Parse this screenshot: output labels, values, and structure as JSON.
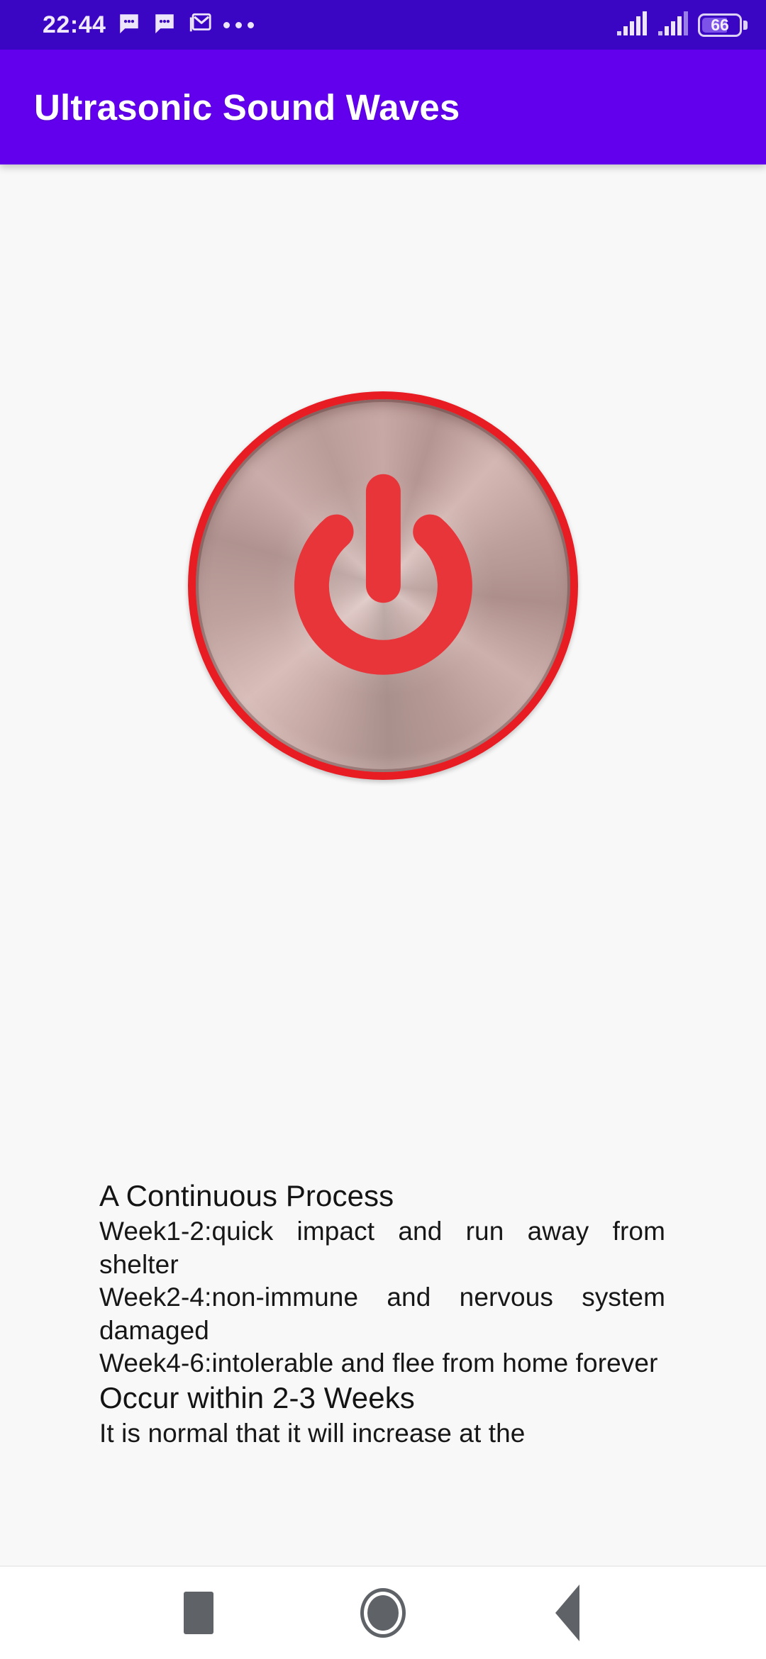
{
  "status_bar": {
    "time": "22:44",
    "icons": [
      "message-icon",
      "message-icon",
      "gmail-icon",
      "more-notifications-icon"
    ],
    "signal_icons": [
      "signal-bars-icon",
      "signal-bars-icon"
    ],
    "battery_level": "66",
    "battery_percent": 66,
    "background_color": "#3A05C3"
  },
  "app_bar": {
    "title": "Ultrasonic Sound Waves",
    "background_color": "#6200EE",
    "text_color": "#FFFFFF"
  },
  "main": {
    "power_button": {
      "icon": "power-icon",
      "ring_color": "#E81C23",
      "glyph_color": "#E8353A",
      "face_color": "#C2A29E",
      "state": "off"
    },
    "info": [
      {
        "type": "heading",
        "text": "A Continuous Process"
      },
      {
        "type": "paragraph",
        "text": "Week1-2:quick impact and run away from shelter"
      },
      {
        "type": "paragraph",
        "text": "Week2-4:non-immune and nervous system damaged"
      },
      {
        "type": "paragraph",
        "text": "Week4-6:intolerable and flee from home forever"
      },
      {
        "type": "heading",
        "text": "Occur within 2-3 Weeks"
      },
      {
        "type": "paragraph",
        "text": "It is normal that it will increase at the"
      }
    ],
    "background_color": "#F8F8F8"
  },
  "nav_bar": {
    "buttons": [
      {
        "name": "recents",
        "icon": "square-icon"
      },
      {
        "name": "home",
        "icon": "circle-icon"
      },
      {
        "name": "back",
        "icon": "triangle-left-icon"
      }
    ],
    "background_color": "#FFFFFF",
    "icon_color": "#5F6368"
  }
}
